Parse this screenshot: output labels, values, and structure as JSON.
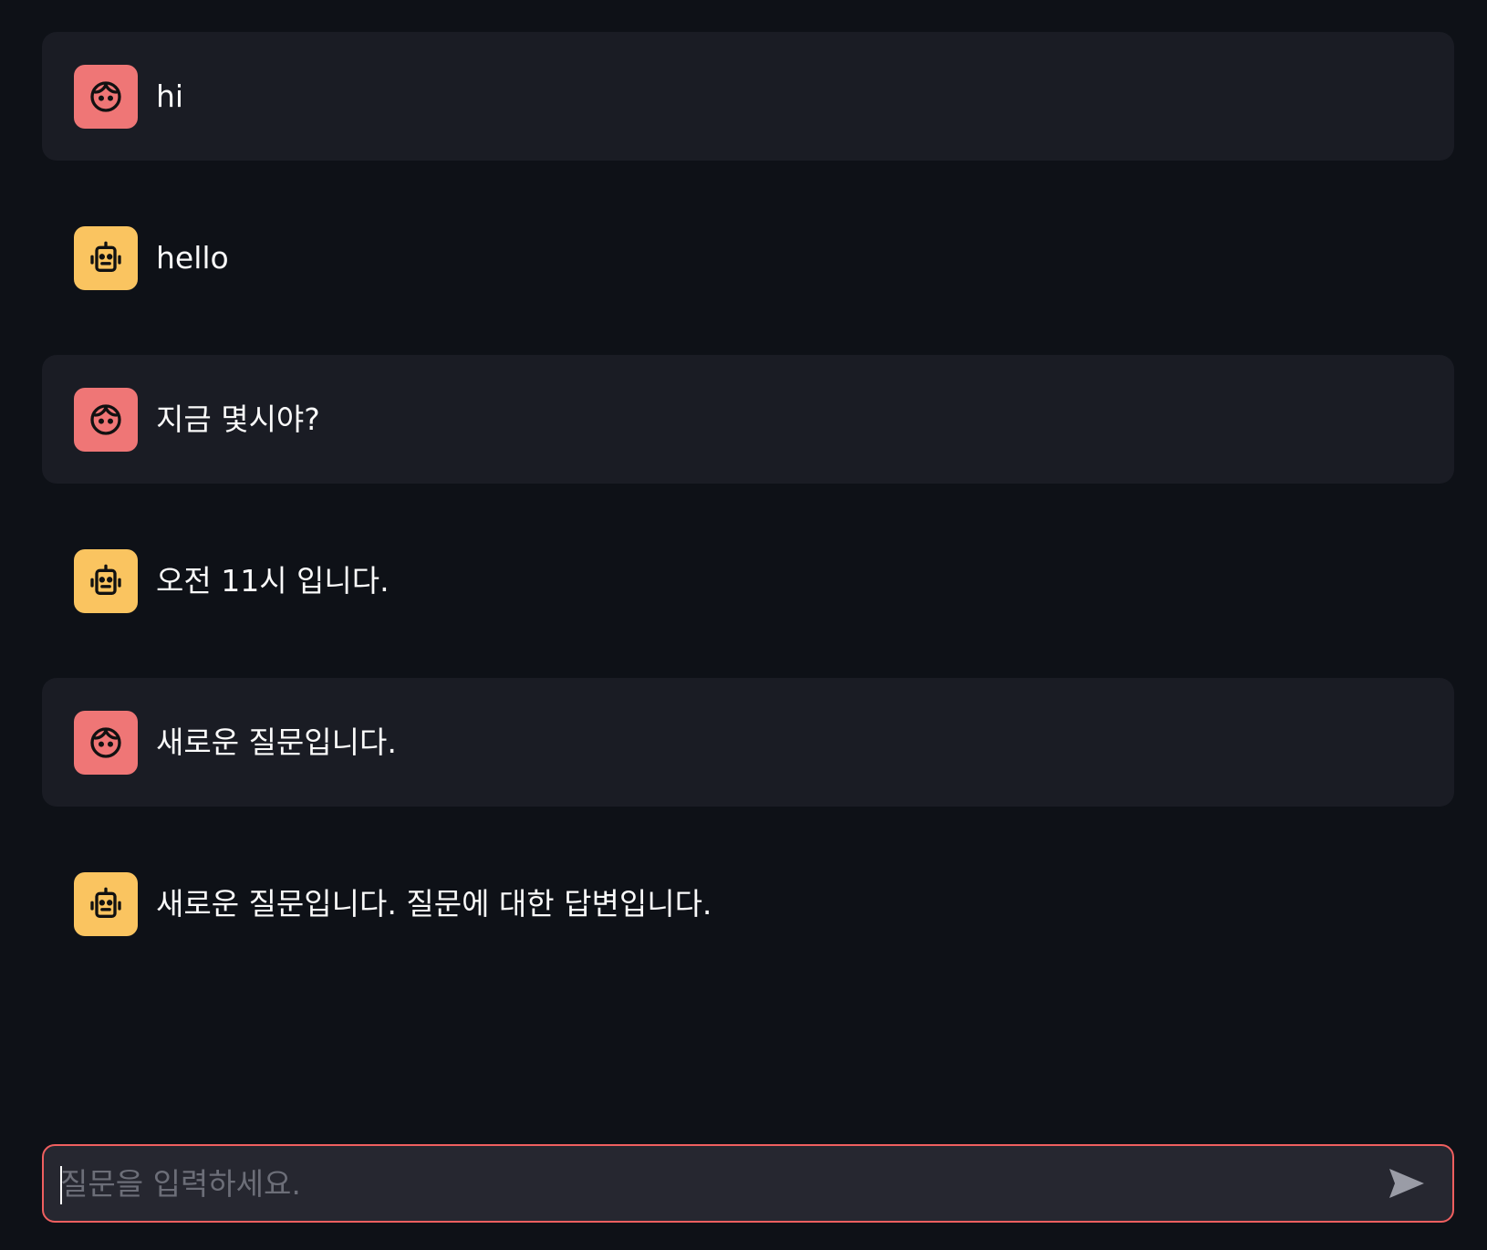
{
  "messages": [
    {
      "role": "user",
      "avatar_icon": "user-face-icon",
      "text": "hi"
    },
    {
      "role": "assistant",
      "avatar_icon": "robot-icon",
      "text": "hello"
    },
    {
      "role": "user",
      "avatar_icon": "user-face-icon",
      "text": "지금 몇시야?"
    },
    {
      "role": "assistant",
      "avatar_icon": "robot-icon",
      "text": "오전 11시 입니다."
    },
    {
      "role": "user",
      "avatar_icon": "user-face-icon",
      "text": "새로운 질문입니다."
    },
    {
      "role": "assistant",
      "avatar_icon": "robot-icon",
      "text": "새로운 질문입니다. 질문에 대한 답변입니다."
    }
  ],
  "chat_input": {
    "placeholder": "질문을 입력하세요.",
    "value": "",
    "send_icon": "send-icon"
  },
  "colors": {
    "background": "#0e1117",
    "user_message_bg": "#1a1c24",
    "user_avatar": "#ef7676",
    "bot_avatar": "#fac460",
    "input_border": "#ef5f5f",
    "input_bg": "#262730"
  }
}
